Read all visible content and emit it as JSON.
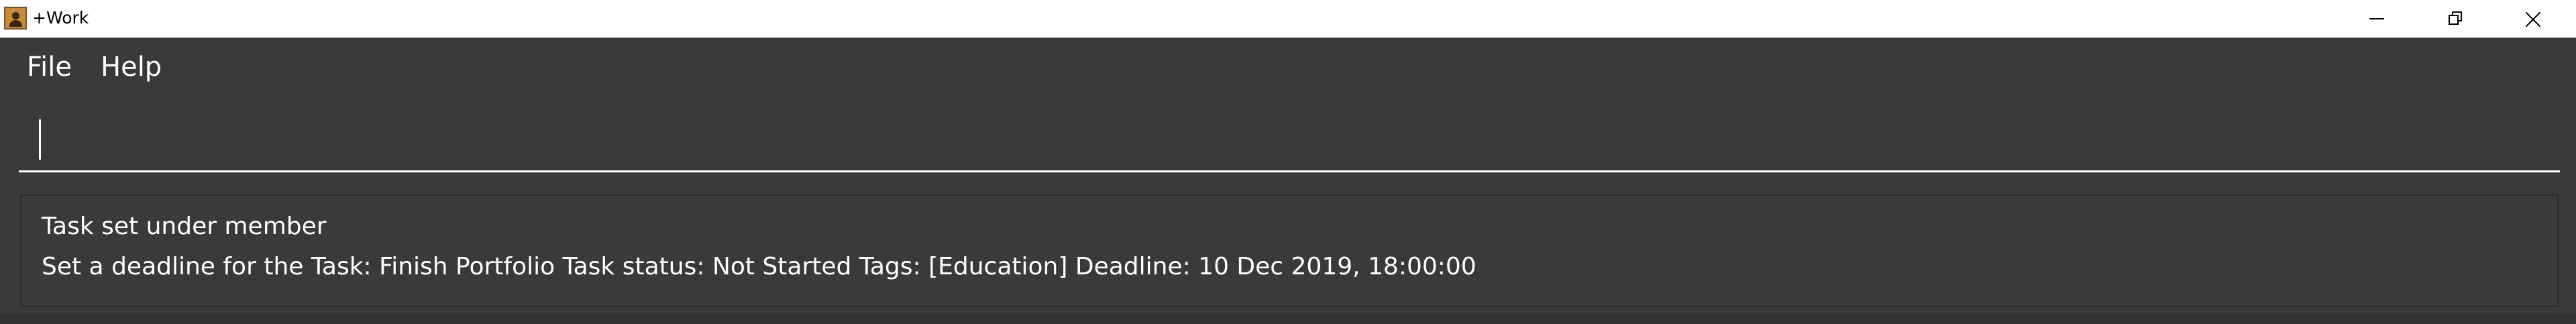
{
  "window": {
    "title": "+Work",
    "icon": "app-person-icon",
    "controls": [
      "minimize-icon",
      "restore-icon",
      "close-icon"
    ]
  },
  "menu": {
    "items": [
      {
        "label": "File"
      },
      {
        "label": "Help"
      }
    ]
  },
  "command": {
    "value": "",
    "placeholder": ""
  },
  "result": {
    "lines": [
      "Task set under member",
      "Set a deadline for the Task: Finish Portfolio Task status: Not Started Tags: [Education] Deadline: 10 Dec 2019, 18:00:00"
    ]
  },
  "colors": {
    "background": "#3a3a3a",
    "titlebar": "#ffffff",
    "text": "#ffffff",
    "input_underline": "#ffffff"
  }
}
